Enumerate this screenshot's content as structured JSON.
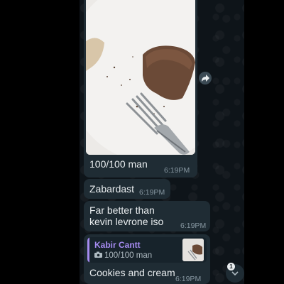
{
  "messages": [
    {
      "type": "image",
      "caption": "100/100 man",
      "time": "6:19PM"
    },
    {
      "type": "text",
      "text": "Zabardast",
      "time": "6:19PM"
    },
    {
      "type": "text",
      "text": "Far better than kevin levrone iso",
      "time": "6:19PM"
    },
    {
      "type": "reply",
      "reply_to": {
        "author": "Kabir Cantt",
        "preview": "100/100 man",
        "media": "camera-icon"
      },
      "text": "Cookies and cream",
      "time": "6:19PM"
    }
  ],
  "scroll_down": {
    "unread_count": "1",
    "icon": "chevron-down-icon"
  },
  "forward": {
    "icon": "forward-icon"
  },
  "colors": {
    "bubble": "#1f2c34",
    "reply_accent": "#a58bf0",
    "time": "#8696a0",
    "background": "#0e1419"
  }
}
